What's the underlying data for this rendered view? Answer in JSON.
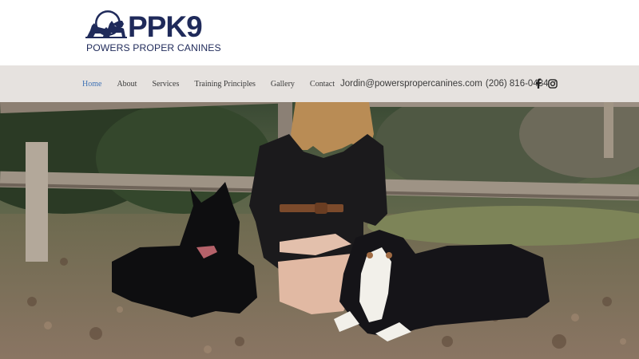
{
  "brand": {
    "title": "PPK9",
    "subtitle": "POWERS PROPER CANINES",
    "color": "#1f2a5a"
  },
  "nav": {
    "items": [
      {
        "label": "Home",
        "active": true
      },
      {
        "label": "About"
      },
      {
        "label": "Services"
      },
      {
        "label": "Training Principles"
      },
      {
        "label": "Gallery"
      },
      {
        "label": "Contact"
      }
    ],
    "active_color": "#3f72b5"
  },
  "contact": {
    "email": "Jordin@powerspropercanines.com",
    "phone": "(206) 816-0434"
  },
  "social": {
    "icons": [
      "facebook-icon",
      "instagram-icon"
    ]
  },
  "hero": {
    "image": "photo-woman-with-two-dogs"
  }
}
